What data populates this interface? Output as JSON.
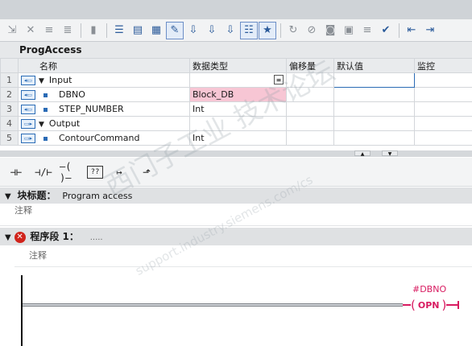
{
  "editor": {
    "title": "ProgAccess"
  },
  "interface": {
    "headers": [
      "名称",
      "数据类型",
      "偏移量",
      "默认值",
      "监控"
    ],
    "rows": [
      {
        "num": "1",
        "name": "Input",
        "type": "",
        "level": 0,
        "expanded": true
      },
      {
        "num": "2",
        "name": "DBNO",
        "type": "Block_DB",
        "level": 1,
        "highlight": true
      },
      {
        "num": "3",
        "name": "STEP_NUMBER",
        "type": "Int",
        "level": 1
      },
      {
        "num": "4",
        "name": "Output",
        "type": "",
        "level": 0,
        "expanded": true
      },
      {
        "num": "5",
        "name": "ContourCommand",
        "type": "Int",
        "level": 1
      }
    ]
  },
  "block": {
    "title_label": "块标题：",
    "title_value": "Program access",
    "comment": "注释"
  },
  "network": {
    "label": "程序段 1：",
    "title": ".....",
    "comment": "注释",
    "has_error": true
  },
  "ladder": {
    "operand": "#DBNO",
    "coil_label": "OPN"
  },
  "watermark": {
    "line1": "西门子工业  技术论坛",
    "line2": "support.industry.siemens.com/cs"
  },
  "colors": {
    "accent": "#2a6bb5",
    "error": "#d0231b",
    "coil": "#d81b60",
    "highlight": "#f7c6d4"
  }
}
